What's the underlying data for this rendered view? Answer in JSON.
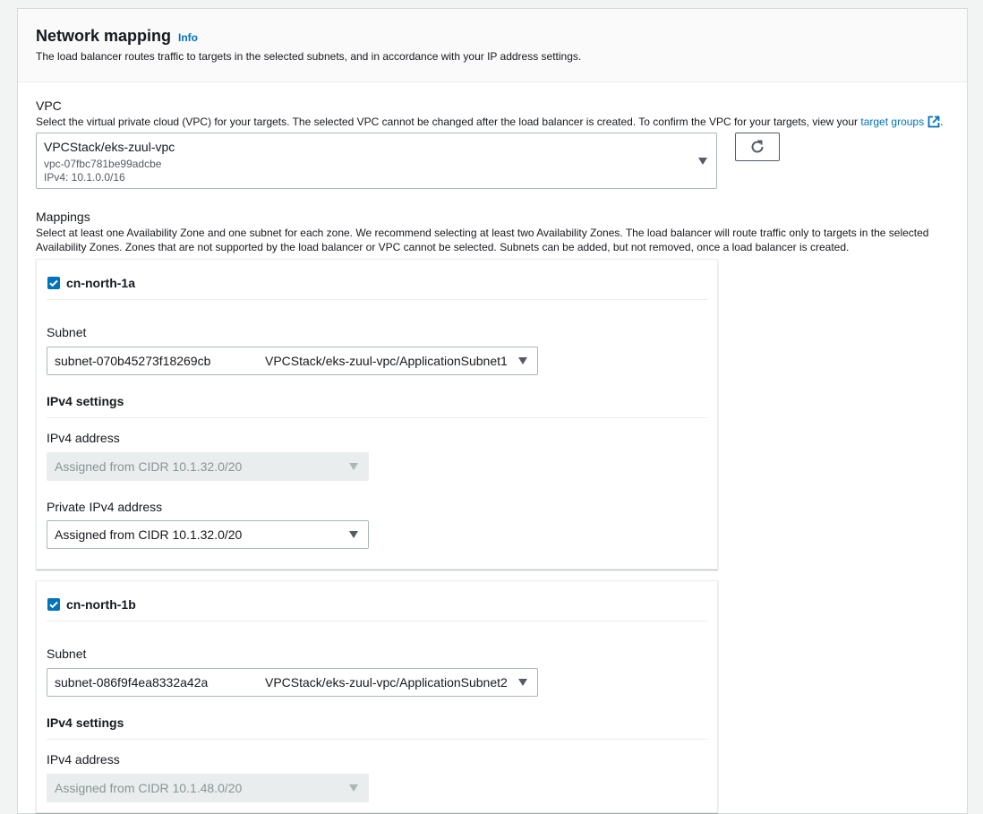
{
  "section": {
    "title": "Network mapping",
    "info_label": "Info",
    "description": "The load balancer routes traffic to targets in the selected subnets, and in accordance with your IP address settings."
  },
  "vpc": {
    "label": "VPC",
    "description": "Select the virtual private cloud (VPC) for your targets. The selected VPC cannot be changed after the load balancer is created. To confirm the VPC for your targets, view your",
    "link_text": "target groups",
    "trailing": ".",
    "selected_name": "VPCStack/eks-zuul-vpc",
    "selected_id": "vpc-07fbc781be99adcbe",
    "selected_cidr": "IPv4: 10.1.0.0/16",
    "refresh_icon": "refresh-icon"
  },
  "mappings": {
    "label": "Mappings",
    "description_line1": "Select at least one Availability Zone and one subnet for each zone. We recommend selecting at least two Availability Zones. The load balancer will route traffic only to targets in the selected",
    "description_line2": "Availability Zones. Zones that are not supported by the load balancer or VPC cannot be selected. Subnets can be added, but not removed, once a load balancer is created.",
    "zones": [
      {
        "name": "cn-north-1a",
        "checked": true,
        "subnet_label": "Subnet",
        "subnet_id": "subnet-070b45273f18269cb",
        "subnet_name": "VPCStack/eks-zuul-vpc/ApplicationSubnet1",
        "ipv4_settings_label": "IPv4 settings",
        "ipv4_address_label": "IPv4 address",
        "ipv4_address_value": "Assigned from CIDR 10.1.32.0/20",
        "private_ipv4_label": "Private IPv4 address",
        "private_ipv4_value": "Assigned from CIDR 10.1.32.0/20"
      },
      {
        "name": "cn-north-1b",
        "checked": true,
        "subnet_label": "Subnet",
        "subnet_id": "subnet-086f9f4ea8332a42a",
        "subnet_name": "VPCStack/eks-zuul-vpc/ApplicationSubnet2",
        "ipv4_settings_label": "IPv4 settings",
        "ipv4_address_label": "IPv4 address",
        "ipv4_address_value": "Assigned from CIDR 10.1.48.0/20"
      }
    ]
  },
  "colors": {
    "link": "#0073bb",
    "checkbox": "#0073bb",
    "text": "#16191f",
    "muted": "#545b64"
  }
}
